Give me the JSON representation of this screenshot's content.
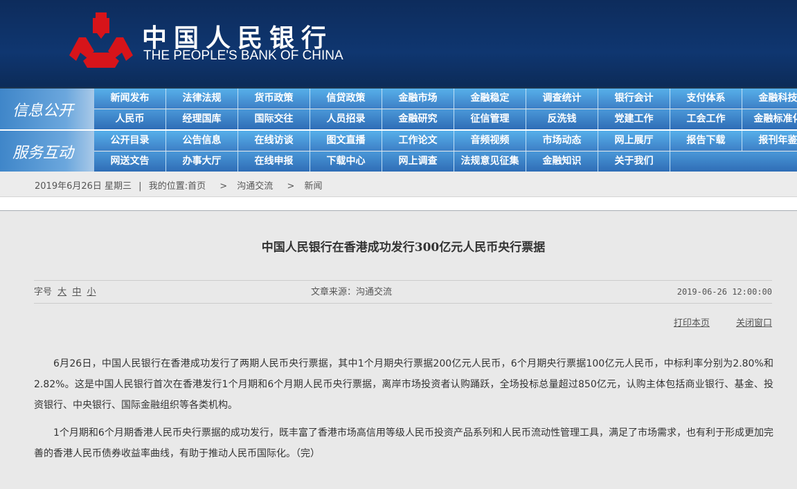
{
  "header": {
    "cn_name": "中国人民银行",
    "en_name": "THE PEOPLE'S BANK OF CHINA"
  },
  "nav": {
    "group1": {
      "label": "信息公开",
      "row1": [
        "新闻发布",
        "法律法规",
        "货币政策",
        "信贷政策",
        "金融市场",
        "金融稳定",
        "调查统计",
        "银行会计",
        "支付体系",
        "金融科技"
      ],
      "row2": [
        "人民币",
        "经理国库",
        "国际交往",
        "人员招录",
        "金融研究",
        "征信管理",
        "反洗钱",
        "党建工作",
        "工会工作",
        "金融标准化"
      ]
    },
    "group2": {
      "label": "服务互动",
      "row1": [
        "公开目录",
        "公告信息",
        "在线访谈",
        "图文直播",
        "工作论文",
        "音频视频",
        "市场动态",
        "网上展厅",
        "报告下载",
        "报刊年鉴"
      ],
      "row2": [
        "网送文告",
        "办事大厅",
        "在线申报",
        "下载中心",
        "网上调查",
        "法规意见征集",
        "金融知识",
        "关于我们"
      ]
    }
  },
  "breadcrumb": {
    "date": "2019年6月26日 星期三",
    "sep": "|",
    "location": "我的位置:首页",
    "arrow": ">",
    "items": [
      "沟通交流",
      "新闻"
    ]
  },
  "article": {
    "title": "中国人民银行在香港成功发行300亿元人民币央行票据",
    "font_label": "字号",
    "font_sizes": [
      "大",
      "中",
      "小"
    ],
    "source": "文章来源：沟通交流",
    "time": "2019-06-26 12:00:00",
    "print": "打印本页",
    "close": "关闭窗口",
    "paragraphs": [
      "6月26日，中国人民银行在香港成功发行了两期人民币央行票据，其中1个月期央行票据200亿元人民币，6个月期央行票据100亿元人民币，中标利率分别为2.80%和2.82%。这是中国人民银行首次在香港发行1个月期和6个月期人民币央行票据，离岸市场投资者认购踊跃，全场投标总量超过850亿元，认购主体包括商业银行、基金、投资银行、中央银行、国际金融组织等各类机构。",
      "1个月期和6个月期香港人民币央行票据的成功发行，既丰富了香港市场高信用等级人民币投资产品系列和人民币流动性管理工具，满足了市场需求，也有利于形成更加完善的香港人民币债券收益率曲线，有助于推动人民币国际化。（完）"
    ]
  }
}
